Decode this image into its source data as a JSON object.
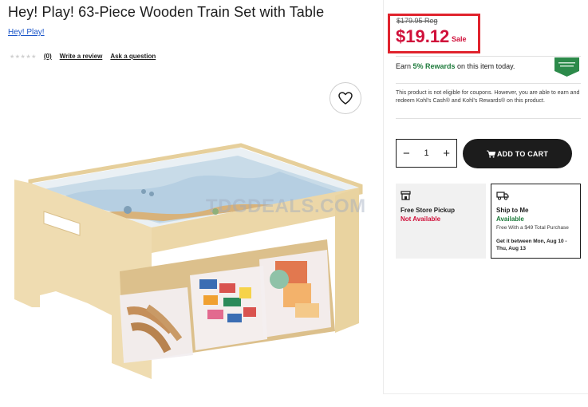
{
  "product": {
    "title": "Hey! Play! 63-Piece Wooden Train Set with Table",
    "brand": "Hey! Play!",
    "review_count": "(0)",
    "write_review": "Write a review",
    "ask_question": "Ask a question",
    "watermark": "TDGDEALS.COM"
  },
  "pricing": {
    "regular": "$179.95 Reg",
    "sale": "$19.12",
    "sale_label": "Sale",
    "sale_color": "#d0103a",
    "highlight_border": "#e0232d"
  },
  "rewards": {
    "prefix": "Earn ",
    "highlight": "5% Rewards",
    "suffix": " on this item today.",
    "badge_icon": "kohls-rewards-badge"
  },
  "coupon_note": "This product is not eligible for coupons. However, you are able to earn and redeem Kohl's Cash® and Kohl's Rewards® on this product.",
  "cart": {
    "quantity": "1",
    "decrement_icon": "minus-icon",
    "increment_icon": "plus-icon",
    "add_label": "ADD TO CART"
  },
  "fulfillment": {
    "store": {
      "title": "Free Store Pickup",
      "status": "Not Available"
    },
    "ship": {
      "title": "Ship to Me",
      "status": "Available",
      "note": "Free With a $49 Total Purchase",
      "eta": "Get it between Mon, Aug 10 - Thu, Aug 13"
    }
  }
}
